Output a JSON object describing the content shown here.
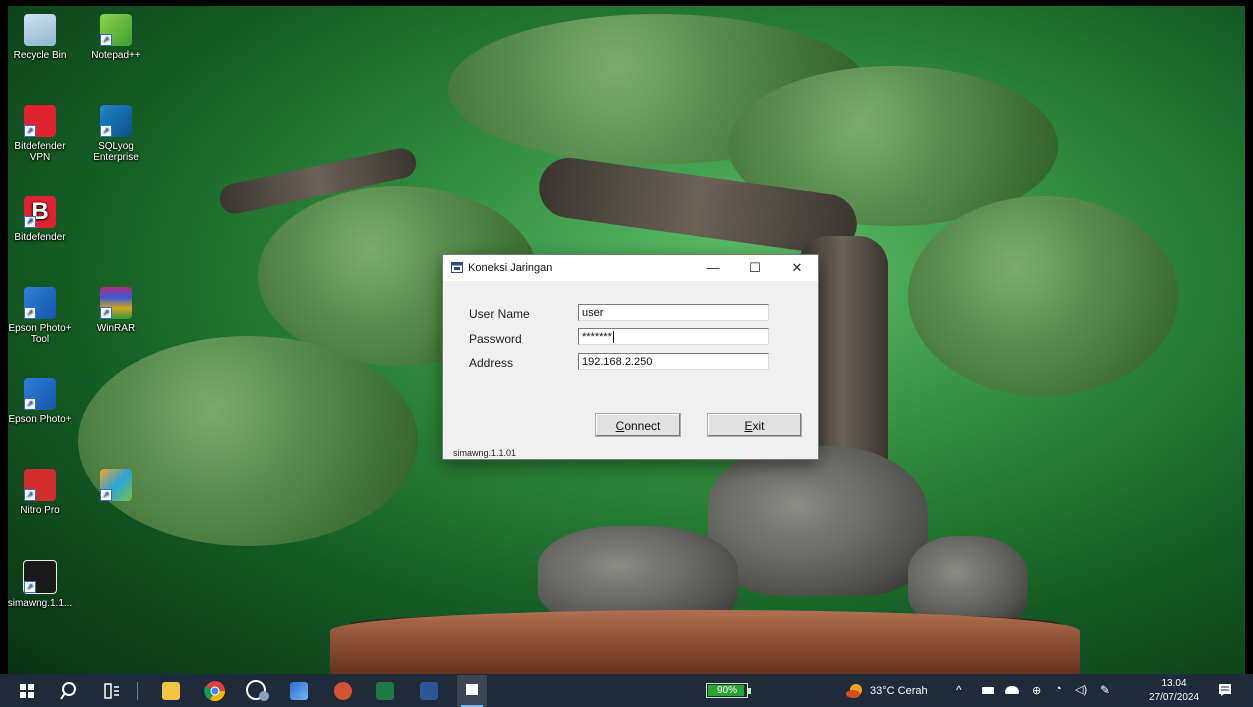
{
  "desktop": {
    "icons": [
      {
        "label": "Recycle Bin",
        "glyph": "recycle-bin-icon"
      },
      {
        "label": "Notepad++",
        "glyph": "notepad-icon"
      },
      {
        "label": "Bitdefender VPN",
        "glyph": "bitdefender-vpn-icon"
      },
      {
        "label": "SQLyog Enterprise",
        "glyph": "sqlyog-icon"
      },
      {
        "label": "Bitdefender",
        "glyph": "bitdefender-icon"
      },
      {
        "label": "Epson Photo+ Tool",
        "glyph": "epson-photo-tool-icon"
      },
      {
        "label": "WinRAR",
        "glyph": "winrar-icon"
      },
      {
        "label": "Epson Photo+",
        "glyph": "epson-photo-icon"
      },
      {
        "label": "Nitro Pro",
        "glyph": "nitro-pro-icon"
      },
      {
        "label": "",
        "glyph": "app-shortcut-icon"
      },
      {
        "label": "simawng.1.1...",
        "glyph": "simawng-icon"
      }
    ]
  },
  "dialog": {
    "title": "Koneksi Jaringan",
    "minimize_glyph": "—",
    "maximize_glyph": "☐",
    "close_glyph": "✕",
    "username_label": "User Name",
    "username_value": "user",
    "password_label": "Password",
    "password_value": "*******",
    "address_label": "Address",
    "address_value": "192.168.2.250",
    "connect_label_hot": "C",
    "connect_label_rest": "onnect",
    "exit_label_hot": "E",
    "exit_label_rest": "xit",
    "version": "simawng.1.1.01"
  },
  "taskbar": {
    "battery_percent": "90%",
    "weather": "33°C  Cerah",
    "time": "13.04",
    "date": "27/07/2024",
    "colors": {
      "background": "#1f2a3a",
      "battery_fill": "#27a535"
    }
  }
}
